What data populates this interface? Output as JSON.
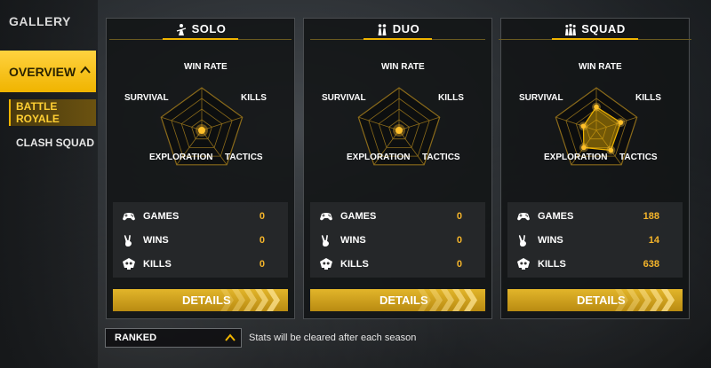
{
  "sidebar": {
    "gallery_label": "GALLERY",
    "overview_label": "OVERVIEW",
    "battle_royale_label": "BATTLE ROYALE",
    "clash_squad_label": "CLASH SQUAD"
  },
  "radar_axes": [
    "WIN RATE",
    "KILLS",
    "TACTICS",
    "EXPLORATION",
    "SURVIVAL"
  ],
  "modes": [
    {
      "title": "SOLO",
      "icon": "solo-player-icon",
      "stats": [
        {
          "label": "GAMES",
          "value": "0",
          "icon": "gamepad-icon"
        },
        {
          "label": "WINS",
          "value": "0",
          "icon": "victory-hand-icon"
        },
        {
          "label": "KILLS",
          "value": "0",
          "icon": "skull-icon"
        }
      ],
      "radar_values": [
        0,
        0,
        0,
        0,
        0
      ],
      "details_label": "DETAILS"
    },
    {
      "title": "DUO",
      "icon": "duo-players-icon",
      "stats": [
        {
          "label": "GAMES",
          "value": "0",
          "icon": "gamepad-icon"
        },
        {
          "label": "WINS",
          "value": "0",
          "icon": "victory-hand-icon"
        },
        {
          "label": "KILLS",
          "value": "0",
          "icon": "skull-icon"
        }
      ],
      "radar_values": [
        0,
        0,
        0,
        0,
        0
      ],
      "details_label": "DETAILS"
    },
    {
      "title": "SQUAD",
      "icon": "squad-players-icon",
      "stats": [
        {
          "label": "GAMES",
          "value": "188",
          "icon": "gamepad-icon"
        },
        {
          "label": "WINS",
          "value": "14",
          "icon": "victory-hand-icon"
        },
        {
          "label": "KILLS",
          "value": "638",
          "icon": "skull-icon"
        }
      ],
      "radar_values": [
        0.55,
        0.6,
        0.58,
        0.5,
        0.32
      ],
      "details_label": "DETAILS"
    }
  ],
  "ranked": {
    "selected": "RANKED"
  },
  "note": "Stats will be cleared after each season",
  "colors": {
    "accent": "#f0b400",
    "value": "#f5b52a"
  }
}
